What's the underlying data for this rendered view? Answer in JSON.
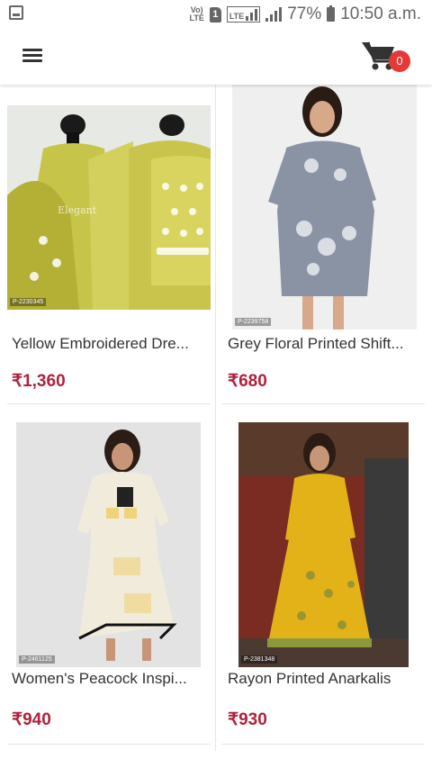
{
  "status_bar": {
    "volte_label": "Vo) LTE",
    "sim_number": "1",
    "network_label": "LTE",
    "battery_percent": "77%",
    "time": "10:50 a.m."
  },
  "app_bar": {
    "cart_count": "0"
  },
  "products": [
    {
      "code": "P-2230345",
      "title": "Yellow Embroidered Dre...",
      "price": "₹1,360",
      "watermark": "Elegant"
    },
    {
      "code": "P-2239758",
      "title": "Grey Floral Printed Shift...",
      "price": "₹680"
    },
    {
      "code": "P-2461125",
      "title": "Women's Peacock Inspi...",
      "price": "₹940"
    },
    {
      "code": "P-2381348",
      "title": "Rayon Printed Anarkalis",
      "price": "₹930"
    }
  ],
  "colors": {
    "price": "#b0213c",
    "badge": "#e53935"
  }
}
